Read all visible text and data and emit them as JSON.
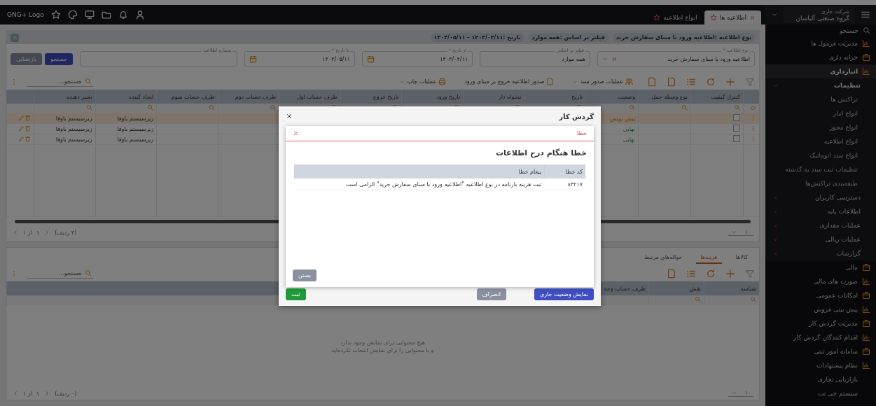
{
  "topbar": {
    "logo": "GNG+ Logo"
  },
  "tabs": [
    {
      "label": "اطلاعیه ها",
      "selected": true
    },
    {
      "label": "انواع اطلاعیه",
      "selected": false
    }
  ],
  "sidebar": {
    "company_label": "شرکت جاری",
    "company": "گروه صنعتی آلیاسان",
    "search_placeholder": "جستجو",
    "items": [
      {
        "label": "مدیریت فرمول ها",
        "selected": false,
        "has_icon": true
      },
      {
        "label": "خزانه داری",
        "selected": false,
        "has_icon": true
      },
      {
        "label": "انبارداری",
        "selected": true,
        "has_icon": true,
        "children": [
          {
            "label": "تنظیمات",
            "expanded": true,
            "children": [
              {
                "label": "تراکنش ها"
              },
              {
                "label": "انواع انبار"
              },
              {
                "label": "انواع مجوز"
              },
              {
                "label": "انواع اطلاعیه"
              },
              {
                "label": "انواع سند اتوماتیک"
              },
              {
                "label": "تنظیمات ثبت سند به گذشته"
              },
              {
                "label": "طبقه‌بندی تراکنش‌ها"
              }
            ]
          },
          {
            "label": "دسترسی کاربران",
            "expanded": false
          },
          {
            "label": "اطلاعات پایه",
            "expanded": false
          },
          {
            "label": "عملیات مقداری",
            "expanded": false
          },
          {
            "label": "عملیات ریالی",
            "expanded": false
          },
          {
            "label": "گزارشات",
            "expanded": false
          }
        ]
      },
      {
        "label": "مالی",
        "selected": false,
        "has_icon": true
      },
      {
        "label": "صورت های مالی",
        "selected": false,
        "has_icon": true
      },
      {
        "label": "امکانات عمومی",
        "selected": false,
        "has_icon": true
      },
      {
        "label": "پیش بینی فروش",
        "selected": false,
        "has_icon": true
      },
      {
        "label": "مدیریت گردش کار",
        "selected": false,
        "has_icon": true
      },
      {
        "label": "اقدام کنندگان گردش کار",
        "selected": false,
        "has_icon": true
      },
      {
        "label": "سامانه امور ثبتی",
        "selected": false,
        "has_icon": true
      },
      {
        "label": "نظام پیشنهادات",
        "selected": false,
        "has_icon": true
      },
      {
        "label": "بازاریابی تجاری",
        "selected": false,
        "has_icon": false
      },
      {
        "label": "سیستم جی نت",
        "selected": false,
        "has_icon": false
      }
    ]
  },
  "filter_summary": [
    "نوع اطلاعیه :اطلاعیه ورود با مبنای سفارش خرید",
    "فیلتر بر اساس :همه موارد",
    "تاریخ :۱۴۰۴/۰۴/۱۱ - ۱۴۰۴/۰۵/۱۱"
  ],
  "fields": [
    {
      "label": "نوع اطلاعیه *",
      "value": "اطلاعیه ورود با مبنای سفارش خرید",
      "kind": "select"
    },
    {
      "label": "فیلتر بر اساس",
      "value": "همه موارد",
      "kind": "plain"
    },
    {
      "label": "از تاریخ *",
      "value": "۱۴۰۴/۰۴/۱۱",
      "kind": "date"
    },
    {
      "label": "تا تاریخ *",
      "value": "۱۴۰۴/۰۵/۱۱",
      "kind": "date"
    },
    {
      "label": "شماره اطلاعیه",
      "kind": "text"
    }
  ],
  "search_buttons": [
    {
      "label": "جستجو",
      "kind": "primary"
    },
    {
      "label": "بازنشانی",
      "kind": "secondary"
    }
  ],
  "toolbar_actions": [
    "عملیات صدور سند",
    "صدور اطلاعیه خروج بر مبنای ورود",
    "عملیات چاپ"
  ],
  "table": {
    "search_placeholder": "جستجو...",
    "columns": [
      "کنترل کیفیت",
      "نوع وسیله حمل",
      "وضعیت",
      "تاریخ",
      "تنخواه دار",
      "تاریخ ورود",
      "تاریخ خروج",
      "طرف حساب اول",
      "طرف حساب دوم",
      "طرف حساب سوم",
      "ایجاد کننده",
      "تغییر دهنده"
    ],
    "rows": [
      {
        "selected": true,
        "checked": false,
        "status": "پیش نویس",
        "kind": "draft",
        "creator": "زیرسیستم باوفا",
        "modifier": "زیرسیستم باوفا"
      },
      {
        "selected": false,
        "checked": false,
        "status": "نهایی",
        "kind": "final",
        "creator": "زیرسیستم باوفا",
        "modifier": "زیرسیستم باوفا"
      },
      {
        "selected": false,
        "checked": false,
        "status": "نهایی",
        "kind": "final",
        "creator": "زیرسیستم باوفا",
        "modifier": "زیرسیستم باوفا"
      }
    ],
    "pagination": {
      "count": "(۳ ردیف)",
      "page": "۱",
      "of": "از ۱",
      "page_size": "۱۰"
    }
  },
  "detail": {
    "tabs": [
      {
        "label": "کالاها",
        "selected": false
      },
      {
        "label": "هزینه‌ها",
        "selected": true
      },
      {
        "label": "حواله‌های مرتبط",
        "selected": false
      }
    ],
    "search_placeholder": "جستجو...",
    "columns": [
      "شناسه",
      "نقش",
      "طرف حساب وجه"
    ],
    "empty_message": [
      "هیچ محتوایی برای نمایش وجود ندارد",
      "و یا محتوایی را برای نمایش انتخاب نکرده‌اید"
    ],
    "pagination": {
      "count": "(۰ ردیف)",
      "page": "۱",
      "of": "از ۱",
      "page_size": "۱۰"
    }
  },
  "dialog": {
    "title": "گردش کار",
    "buttons": [
      {
        "label": "نمایش وضعیت جاری",
        "kind": "primary"
      },
      {
        "label": "انصراف",
        "kind": "secondary"
      },
      {
        "label": "ثبت",
        "kind": "success"
      }
    ],
    "error": {
      "title": "خطا",
      "heading": "خطا هنگام درج اطلاعات",
      "columns": [
        "کد خطا",
        "پیغام خطا"
      ],
      "rows": [
        {
          "code": "۸۳۲۱۷",
          "message": "ثبت هزینه بارنامه در نوع اطلاعیه \"اطلاعیه ورود با مبنای سفارش خرید\" الزامی است"
        }
      ],
      "close_button": "بستن"
    }
  }
}
